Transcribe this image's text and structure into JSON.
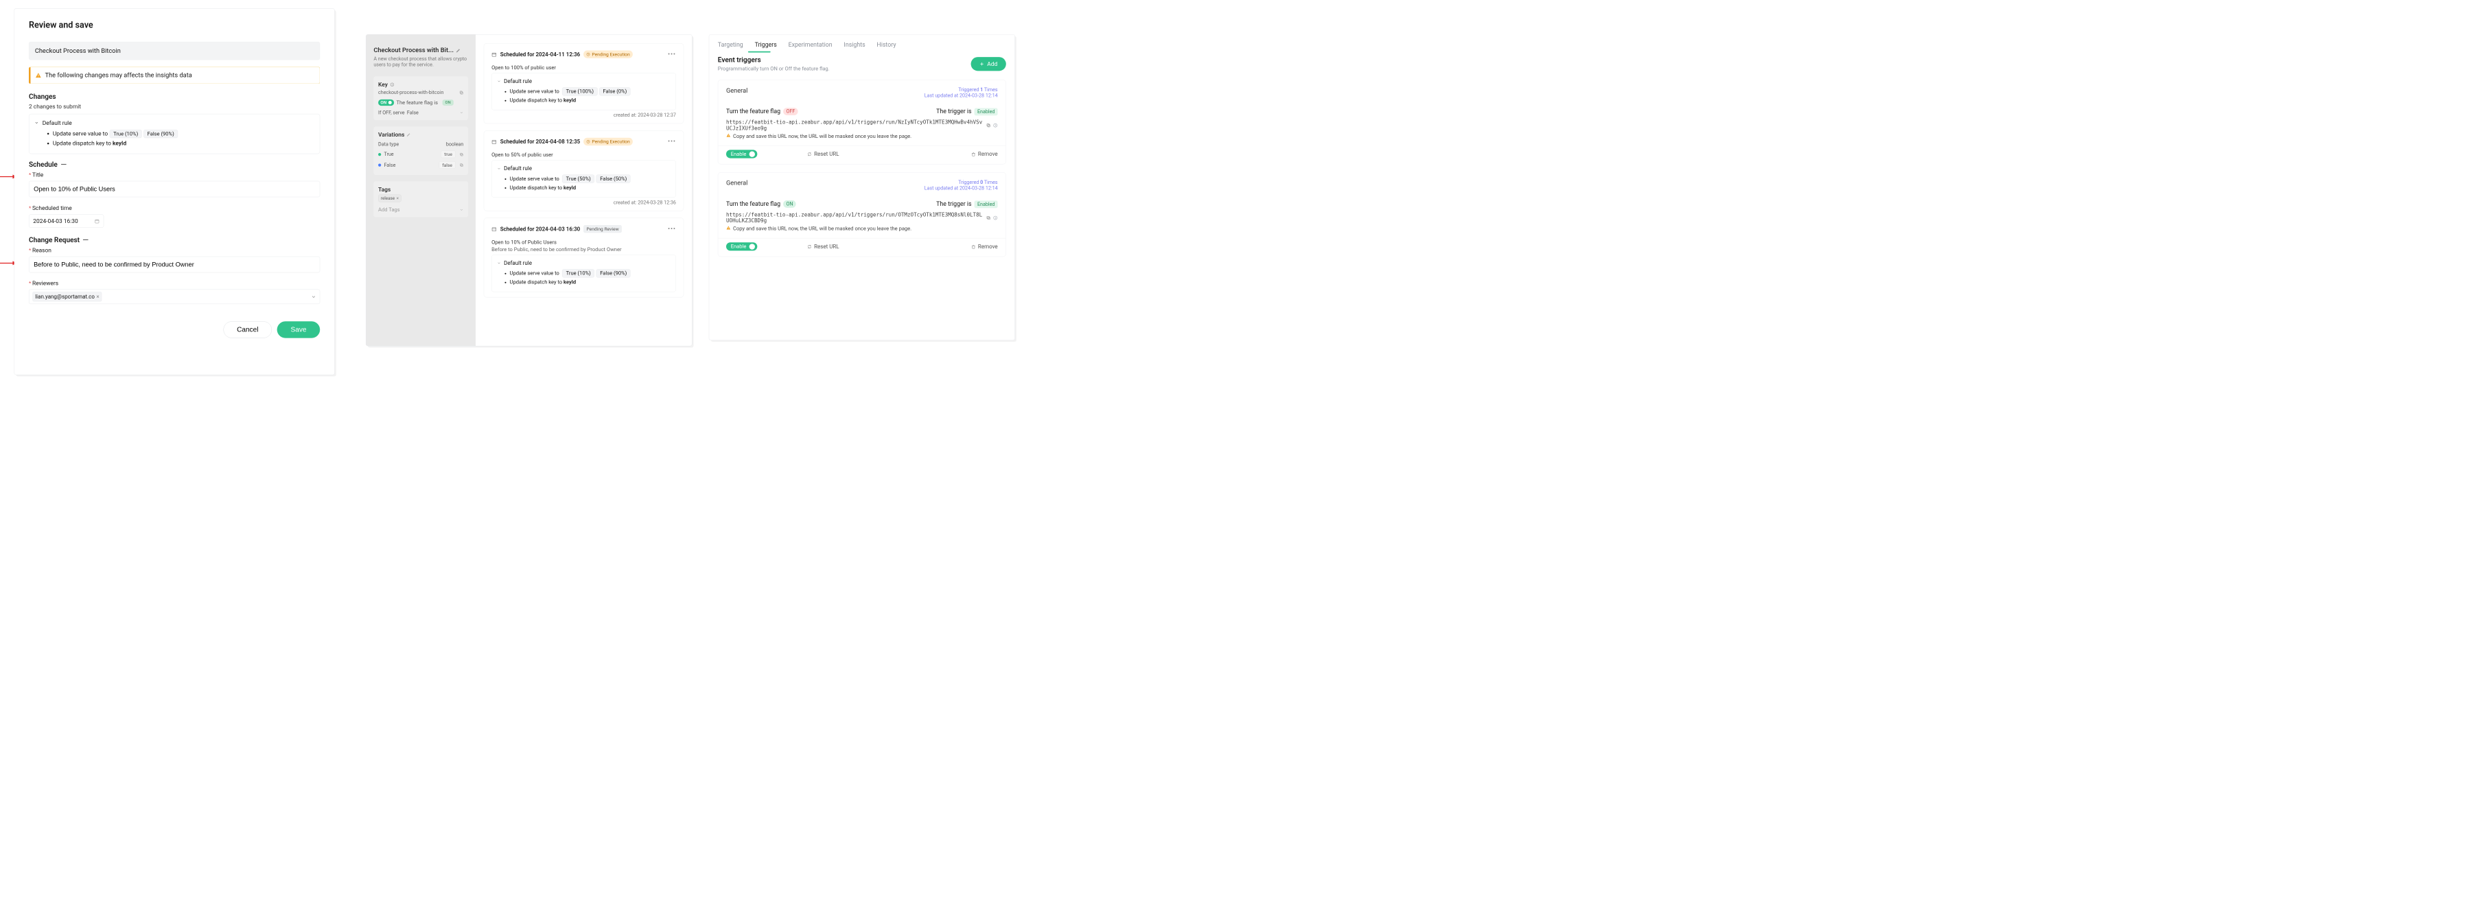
{
  "panel1": {
    "title": "Review and save",
    "flag_name": "Checkout Process with Bitcoin",
    "warning": "The following changes may affects the insights data",
    "changes_header": "Changes",
    "changes_sub": "2 changes to submit",
    "change_group": "Default rule",
    "change_items": [
      {
        "label": "Update serve value to",
        "pills": [
          "True (10%)",
          "False (90%)"
        ]
      },
      {
        "label": "Update dispatch key to",
        "emph": "keyId"
      }
    ],
    "schedule_section": "Schedule",
    "title_label": "Title",
    "title_value": "Open to 10% of Public Users",
    "scheduled_time_label": "Scheduled time",
    "scheduled_time_value": "2024-04-03 16:30",
    "cr_section": "Change Request",
    "reason_label": "Reason",
    "reason_value": "Before to Public, need to be confirmed by Product Owner",
    "reviewers_label": "Reviewers",
    "reviewers": [
      "lian.yang@sportamat.co"
    ],
    "cancel": "Cancel",
    "save": "Save"
  },
  "panel2": {
    "flag_title": "Checkout Process with Bit...",
    "flag_desc": "A new checkout process that allows crypto users to pay for the service.",
    "key_label": "Key",
    "key_value": "checkout-process-with-bitcoin",
    "flag_status_text": "The feature flag is",
    "flag_status": "ON",
    "if_off_label": "If OFF, serve",
    "if_off_value": "False",
    "variations_label": "Variations",
    "data_type_label": "Data type",
    "data_type": "boolean",
    "variations": [
      {
        "name": "True",
        "value": "true",
        "color": "green"
      },
      {
        "name": "False",
        "value": "false",
        "color": "blue"
      }
    ],
    "tags_label": "Tags",
    "tags": [
      "release"
    ],
    "add_tags_placeholder": "Add Tags",
    "schedule_cards": [
      {
        "when": "Scheduled for 2024-04-11 12:36",
        "status": "Pending Execution",
        "status_kind": "orange",
        "sub": "Open to 100% of public user",
        "group": "Default rule",
        "items": [
          {
            "label": "Update serve value to",
            "pills": [
              "True (100%)",
              "False (0%)"
            ]
          },
          {
            "label": "Update dispatch key to",
            "emph": "keyId"
          }
        ],
        "created": "created at: 2024-03-28 12:37"
      },
      {
        "when": "Scheduled for 2024-04-08 12:35",
        "status": "Pending Execution",
        "status_kind": "orange",
        "sub": "Open to 50% of public user",
        "group": "Default rule",
        "items": [
          {
            "label": "Update serve value to",
            "pills": [
              "True (50%)",
              "False (50%)"
            ]
          },
          {
            "label": "Update dispatch key to",
            "emph": "keyId"
          }
        ],
        "created": "created at: 2024-03-28 12:36"
      },
      {
        "when": "Scheduled for 2024-04-03 16:30",
        "status": "Pending Review",
        "status_kind": "gray",
        "sub": "Open to 10% of Public Users",
        "cr_sub": "Before to Public, need to be confirmed by Product Owner",
        "group": "Default rule",
        "items": [
          {
            "label": "Update serve value to",
            "pills": [
              "True (10%)",
              "False (90%)"
            ]
          },
          {
            "label": "Update dispatch key to",
            "emph": "keyId"
          }
        ],
        "created": ""
      }
    ]
  },
  "panel3": {
    "tabs": [
      "Targeting",
      "Triggers",
      "Experimentation",
      "Insights",
      "History"
    ],
    "active_tab": "Triggers",
    "section_title": "Event triggers",
    "section_desc": "Programmatically turn ON or Off the feature flag.",
    "add_label": "Add",
    "warn_masked": "Copy and save this URL now, the URL will be masked once you leave the page.",
    "trigger_is_label": "The trigger is",
    "enabled_label": "Enabled",
    "enable_label": "Enable",
    "reset_label": "Reset URL",
    "remove_label": "Remove",
    "triggers": [
      {
        "category": "General",
        "count_prefix": "Triggered ",
        "count": "1",
        "count_suffix": " Times",
        "last_updated": "Last updated at 2024-03-28 12:14",
        "action_text": "Turn the feature flag",
        "action_kind": "OFF",
        "url": "https://featbit-tio-api.zeabur.app/api/v1/triggers/run/NzIyNTcyOTk1MTE3MQHwBv4hVSvUCJzIXUf3eo9g"
      },
      {
        "category": "General",
        "count_prefix": "Triggered ",
        "count": "0",
        "count_suffix": " Times",
        "last_updated": "Last updated at 2024-03-28 12:14",
        "action_text": "Turn the feature flag",
        "action_kind": "ON",
        "url": "https://featbit-tio-api.zeabur.app/api/v1/triggers/run/OTMzOTcyOTk1MTE3MQ8sNl0LT8LUOHuLKZ3CBD9g"
      }
    ]
  }
}
